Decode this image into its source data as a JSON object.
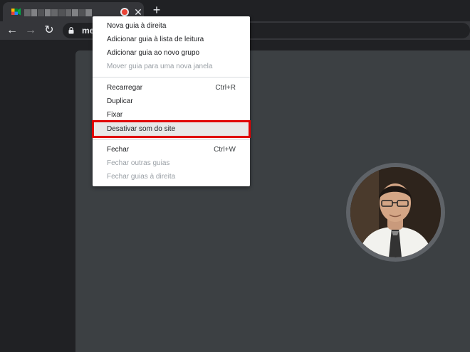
{
  "browser": {
    "tab": {
      "favicon": "google-meet-icon",
      "recording_indicator": "recording-dot-icon",
      "close_glyph": "✕"
    },
    "new_tab_glyph": "+",
    "toolbar": {
      "back_glyph": "←",
      "forward_glyph": "→",
      "reload_glyph": "↻",
      "url": "me"
    }
  },
  "context_menu": {
    "groups": [
      [
        {
          "label": "Nova guia à direita",
          "enabled": true
        },
        {
          "label": "Adicionar guia à lista de leitura",
          "enabled": true
        },
        {
          "label": "Adicionar guia ao novo grupo",
          "enabled": true
        },
        {
          "label": "Mover guia para uma nova janela",
          "enabled": false
        }
      ],
      [
        {
          "label": "Recarregar",
          "shortcut": "Ctrl+R",
          "enabled": true
        },
        {
          "label": "Duplicar",
          "enabled": true
        },
        {
          "label": "Fixar",
          "enabled": true
        },
        {
          "label": "Desativar som do site",
          "enabled": true,
          "highlighted": true
        }
      ],
      [
        {
          "label": "Fechar",
          "shortcut": "Ctrl+W",
          "enabled": true
        },
        {
          "label": "Fechar outras guias",
          "enabled": false
        },
        {
          "label": "Fechar guias à direita",
          "enabled": false
        }
      ]
    ]
  },
  "colors": {
    "highlight_border": "#e00000",
    "menu_background": "#ffffff",
    "meet_panel": "#3c4043"
  }
}
